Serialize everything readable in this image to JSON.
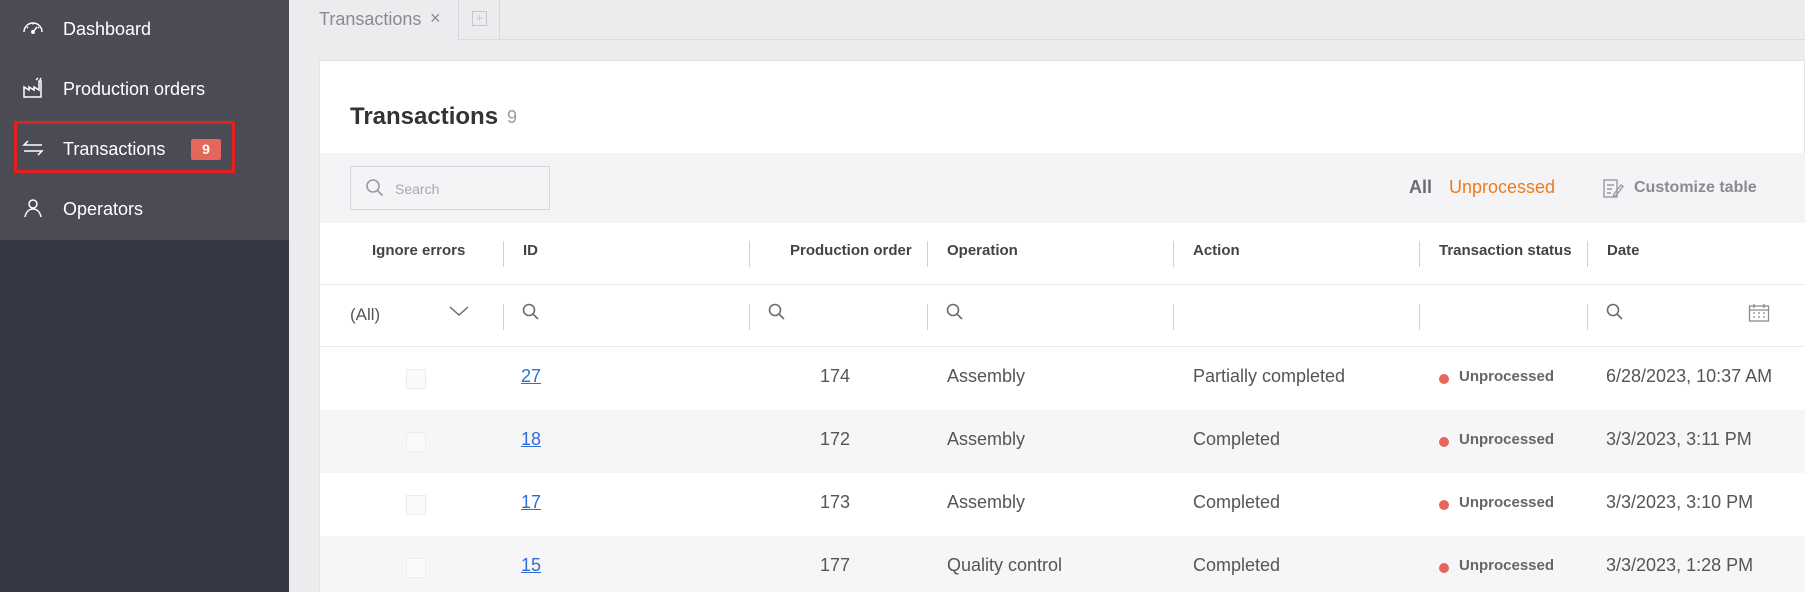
{
  "sidebar": {
    "items": [
      {
        "label": "Dashboard",
        "icon": "gauge-icon"
      },
      {
        "label": "Production orders",
        "icon": "factory-icon"
      },
      {
        "label": "Transactions",
        "icon": "arrows-exchange-icon",
        "badge": "9"
      },
      {
        "label": "Operators",
        "icon": "user-icon"
      }
    ]
  },
  "tabs": [
    {
      "label": "Transactions",
      "close": "×"
    }
  ],
  "page": {
    "title": "Transactions",
    "count": "9"
  },
  "toolbar": {
    "search_placeholder": "Search",
    "filter_all": "All",
    "filter_unprocessed": "Unprocessed",
    "customize_label": "Customize table"
  },
  "table": {
    "columns": [
      "Ignore errors",
      "ID",
      "Production order",
      "Operation",
      "Action",
      "Transaction status",
      "Date"
    ],
    "filter_all_value": "(All)",
    "rows": [
      {
        "id": "27",
        "production_order": "174",
        "operation": "Assembly",
        "action": "Partially completed",
        "status": "Unprocessed",
        "date": "6/28/2023, 10:37 AM"
      },
      {
        "id": "18",
        "production_order": "172",
        "operation": "Assembly",
        "action": "Completed",
        "status": "Unprocessed",
        "date": "3/3/2023, 3:11 PM"
      },
      {
        "id": "17",
        "production_order": "173",
        "operation": "Assembly",
        "action": "Completed",
        "status": "Unprocessed",
        "date": "3/3/2023, 3:10 PM"
      },
      {
        "id": "15",
        "production_order": "177",
        "operation": "Quality control",
        "action": "Completed",
        "status": "Unprocessed",
        "date": "3/3/2023, 1:28 PM"
      }
    ]
  },
  "colors": {
    "sidebar_bg": "#373845",
    "sidebar_menu_bg": "#4a4b54",
    "badge": "#e5675c",
    "accent_orange": "#f07a1a",
    "link_blue": "#2d6fd6",
    "status_dot": "#e5675c",
    "highlight": "#e5201c"
  }
}
